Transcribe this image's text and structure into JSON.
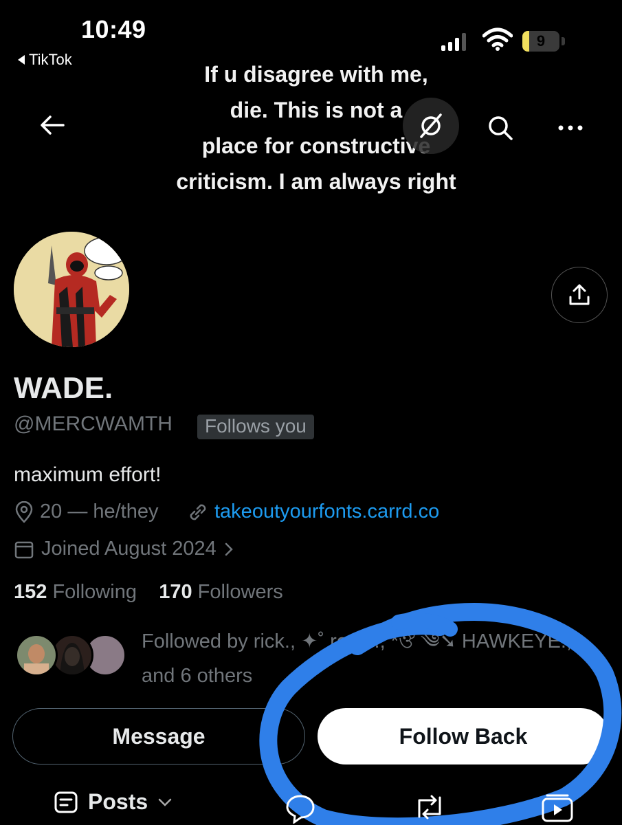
{
  "status_bar": {
    "time": "10:49",
    "back_app": "TikTok",
    "battery_level": "9",
    "battery_color": "#f2e05e"
  },
  "header": {
    "banner_text": "If u disagree with me,\ndie.      This is not a\nplace for constructive\ncriticism. I am always right",
    "icons": [
      "back-arrow-icon",
      "grok-icon",
      "search-icon",
      "more-icon"
    ]
  },
  "profile": {
    "name": "WADE.",
    "handle": "@MERCWAMTH",
    "follows_badge": "Follows you",
    "bio": "maximum effort!",
    "location": "20 — he/they",
    "website": "takeoutyourfonts.carrd.co",
    "joined": "Joined August 2024",
    "following_count": "152",
    "following_label": "Following",
    "followers_count": "170",
    "followers_label": "Followers",
    "followed_by_text": "Followed by rick., ✦˚ rose ., *ঔ ༄➘ HAWKEYE., and 6 others"
  },
  "actions": {
    "message_label": "Message",
    "follow_back_label": "Follow Back"
  },
  "tabs": {
    "posts_label": "Posts"
  },
  "colors": {
    "background": "#000000",
    "link": "#1d9bf0",
    "secondary_text": "#71767b",
    "annotation_scribble": "#2f7fe9"
  }
}
